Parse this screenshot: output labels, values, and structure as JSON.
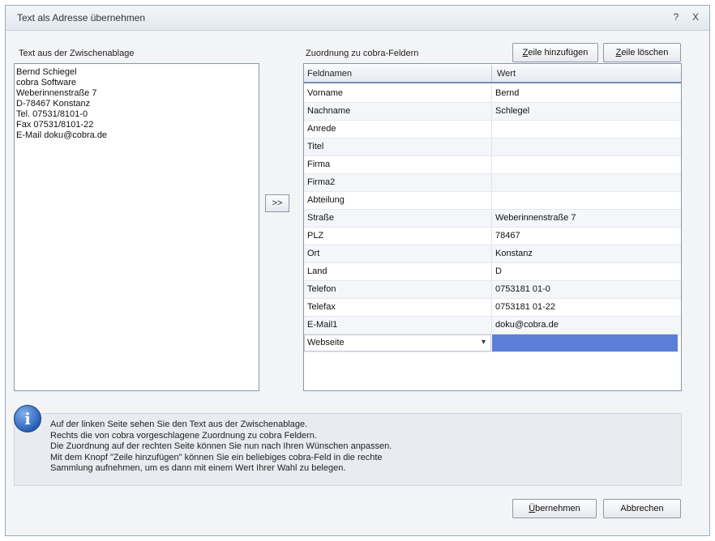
{
  "window": {
    "title": "Text als Adresse übernehmen",
    "help_glyph": "?",
    "close_glyph": "X"
  },
  "left": {
    "label": "Text aus der Zwischenablage",
    "lines": [
      "Bernd Schiegel",
      "cobra Software",
      "Weberinnenstraße 7",
      "D-78467 Konstanz",
      "Tel. 07531/8101-0",
      "Fax 07531/8101-22",
      "E-Mail doku@cobra.de"
    ]
  },
  "transfer_button": ">>",
  "right": {
    "label": "Zuordnung zu cobra-Feldern",
    "add_row_first": "Z",
    "add_row_rest": "eile hinzufügen",
    "delete_row_first": "Z",
    "delete_row_rest": "eile löschen",
    "columns": [
      "Feldnamen",
      "Wert"
    ],
    "rows": [
      {
        "field": "Vorname",
        "value": "Bernd"
      },
      {
        "field": "Nachname",
        "value": "Schlegel"
      },
      {
        "field": "Anrede",
        "value": ""
      },
      {
        "field": "Titel",
        "value": ""
      },
      {
        "field": "Firma",
        "value": ""
      },
      {
        "field": "Firma2",
        "value": ""
      },
      {
        "field": "Abteilung",
        "value": ""
      },
      {
        "field": "Straße",
        "value": "Weberinnenstraße 7"
      },
      {
        "field": "PLZ",
        "value": "78467"
      },
      {
        "field": "Ort",
        "value": "Konstanz"
      },
      {
        "field": "Land",
        "value": "D"
      },
      {
        "field": "Telefon",
        "value": "0753181 01-0"
      },
      {
        "field": "Telefax",
        "value": "0753181 01-22"
      },
      {
        "field": "E-Mail1",
        "value": "doku@cobra.de"
      }
    ],
    "edit_row": {
      "field": "Webseite",
      "dropdown_glyph": "▾",
      "value": ""
    }
  },
  "info": {
    "icon_glyph": "i",
    "lines": [
      "Auf der linken Seite sehen Sie den Text aus der Zwischenablage.",
      "Rechts die von cobra vorgeschlagene Zuordnung zu cobra Feldern.",
      "Die Zuordnung auf der rechten Seite können Sie nun nach Ihren Wünschen anpassen.",
      "Mit dem Knopf \"Zeile hinzufügen\" können Sie ein beliebiges cobra-Feld in die rechte",
      "Sammlung aufnehmen, um es dann mit einem Wert Ihrer Wahl zu belegen."
    ]
  },
  "footer": {
    "ok_first": "Ü",
    "ok_rest": "bernehmen",
    "cancel": "Abbrechen"
  }
}
